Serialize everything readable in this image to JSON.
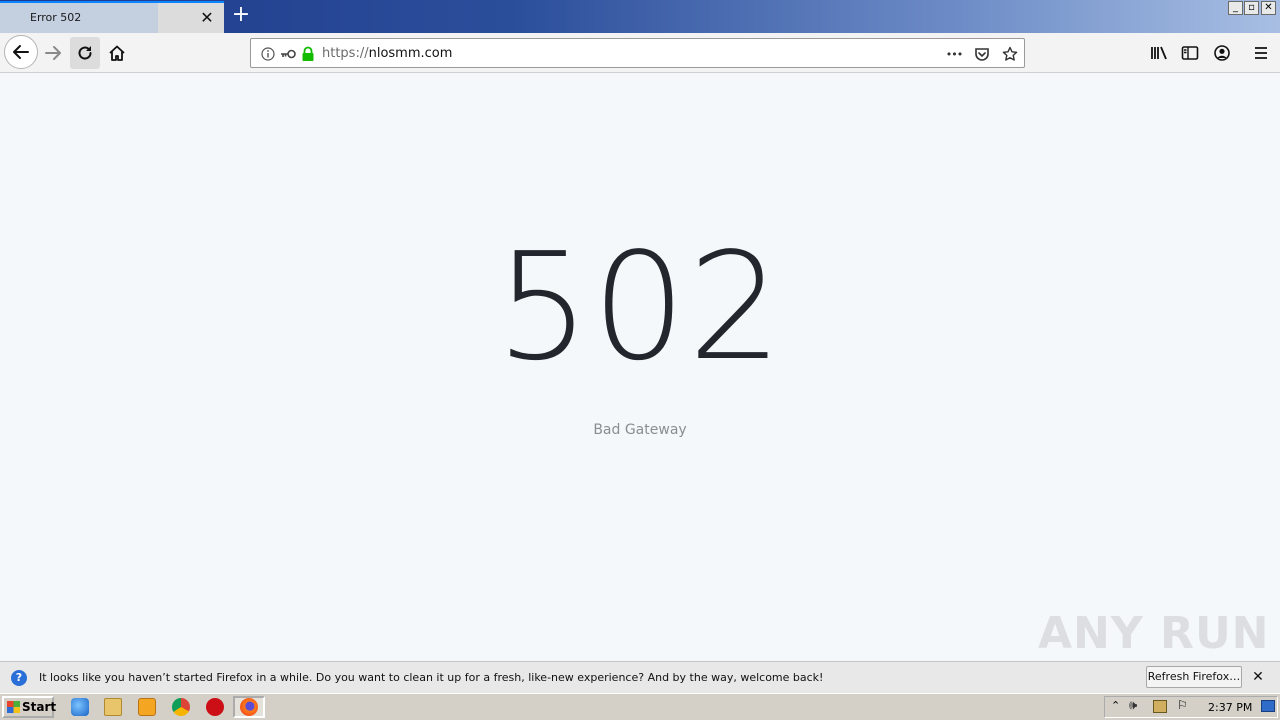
{
  "window": {
    "tab_title": "Error 502",
    "new_tab_label": "+"
  },
  "toolbar": {
    "url_scheme": "https://",
    "url_host": "nlosmm.com",
    "more_actions": "•••"
  },
  "page": {
    "error_code": "502",
    "error_message": "Bad Gateway",
    "watermark": "ANY RUN"
  },
  "notification": {
    "icon": "?",
    "message": "It looks like you haven’t started Firefox in a while. Do you want to clean it up for a fresh, like-new experience? And by the way, welcome back!",
    "button_label": "Refresh Firefox…",
    "close_label": "✕"
  },
  "taskbar": {
    "start_label": "Start",
    "clock": "2:37 PM"
  },
  "colors": {
    "accent": "#0a84ff",
    "lock_green": "#12bc00",
    "page_bg": "#f5f8fa",
    "error_code": "#23262d"
  }
}
